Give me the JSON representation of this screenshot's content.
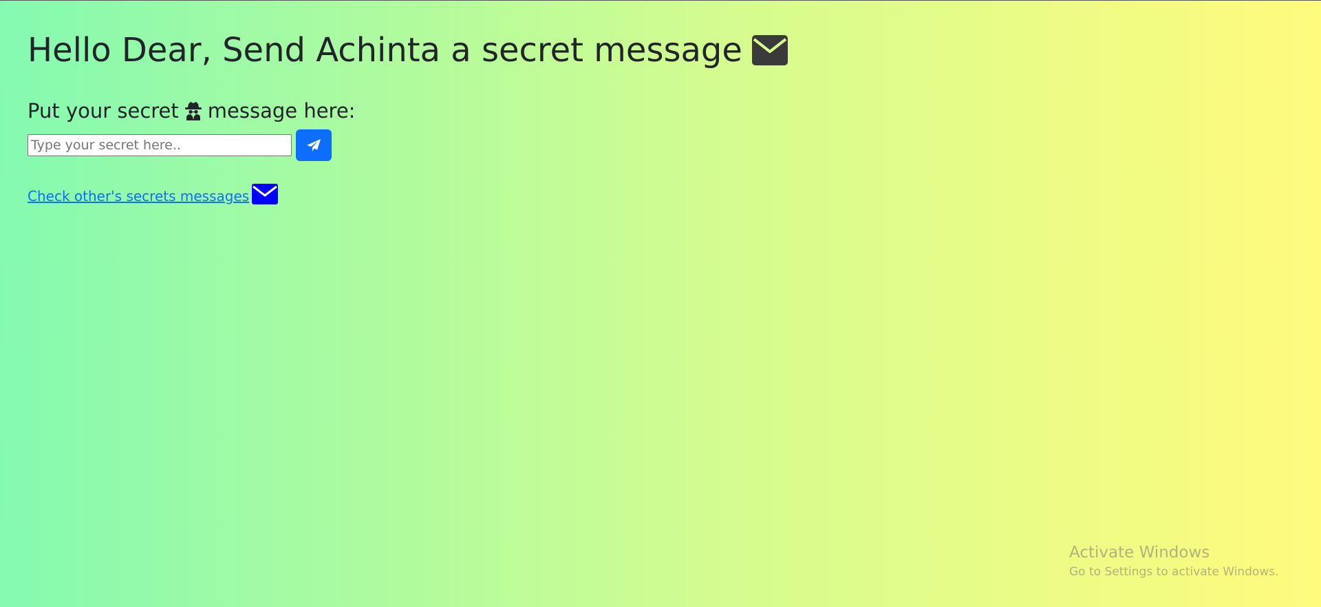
{
  "header": {
    "title": "Hello Dear, Send Achinta a secret message",
    "title_icon": "envelope-icon"
  },
  "form": {
    "label_before": "Put your secret",
    "label_icon": "spy-icon",
    "label_after": "message here:",
    "input_placeholder": "Type your secret here..",
    "input_value": "",
    "send_icon": "paper-plane-icon"
  },
  "link": {
    "text": "Check other's secrets messages",
    "icon": "envelope-icon"
  },
  "watermark": {
    "title": "Activate Windows",
    "subtitle": "Go to Settings to activate Windows."
  },
  "colors": {
    "gradient_start": "#84fab0",
    "gradient_mid": "#d4fc8f",
    "gradient_end": "#fffb7d",
    "button": "#0d6efd",
    "link": "#0d6efd",
    "link_icon": "#0000ff"
  }
}
